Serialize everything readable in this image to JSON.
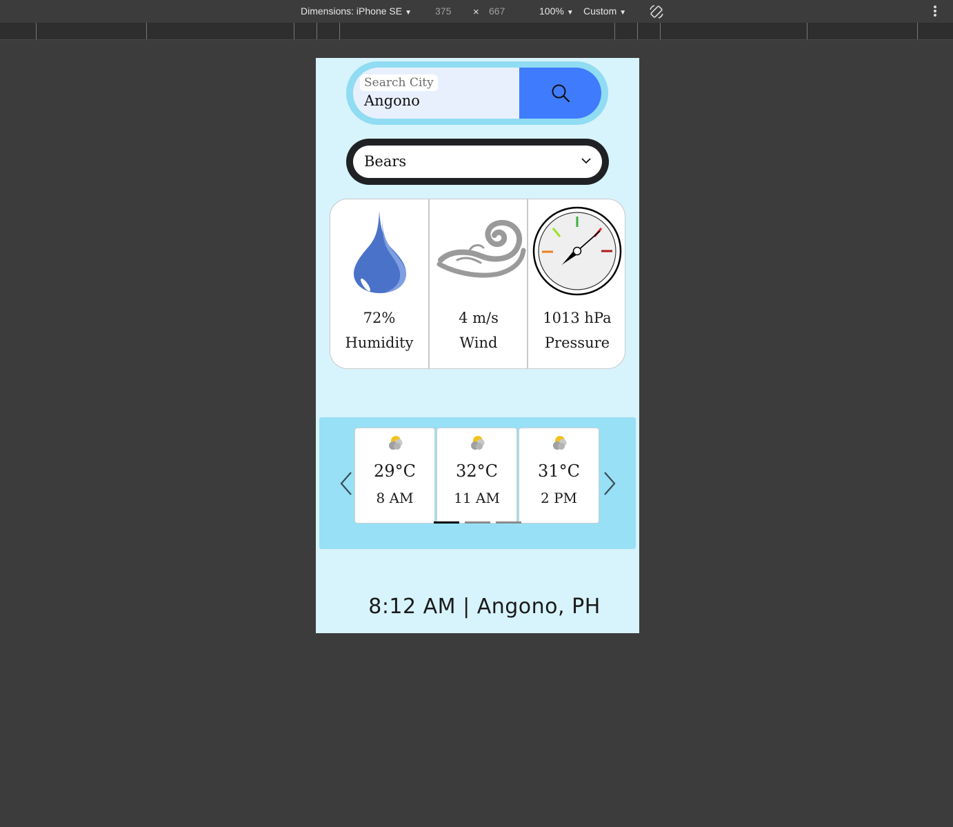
{
  "devtools": {
    "dimensions_label": "Dimensions: iPhone SE",
    "width": "375",
    "times": "×",
    "height": "667",
    "zoom": "100%",
    "throttle": "Custom"
  },
  "search": {
    "label": "Search City",
    "value": "Angono"
  },
  "select": {
    "value": "Bears"
  },
  "stats": [
    {
      "value": "72%",
      "label": "Humidity",
      "icon": "water-drop-icon"
    },
    {
      "value": "4 m/s",
      "label": "Wind",
      "icon": "wind-swirl-icon"
    },
    {
      "value": "1013 hPa",
      "label": "Pressure",
      "icon": "barometer-gauge-icon"
    }
  ],
  "forecast": [
    {
      "temp": "29°C",
      "time": "8 AM",
      "icon": "partly-cloudy-icon"
    },
    {
      "temp": "32°C",
      "time": "11 AM",
      "icon": "partly-cloudy-icon"
    },
    {
      "temp": "31°C",
      "time": "2 PM",
      "icon": "partly-cloudy-icon"
    }
  ],
  "footer": {
    "text": "8:12 AM | Angono, PH"
  },
  "colors": {
    "page_bg": "#d7f3fb",
    "search_button": "#3f7bfd",
    "forecast_bg": "#97e0f6"
  }
}
